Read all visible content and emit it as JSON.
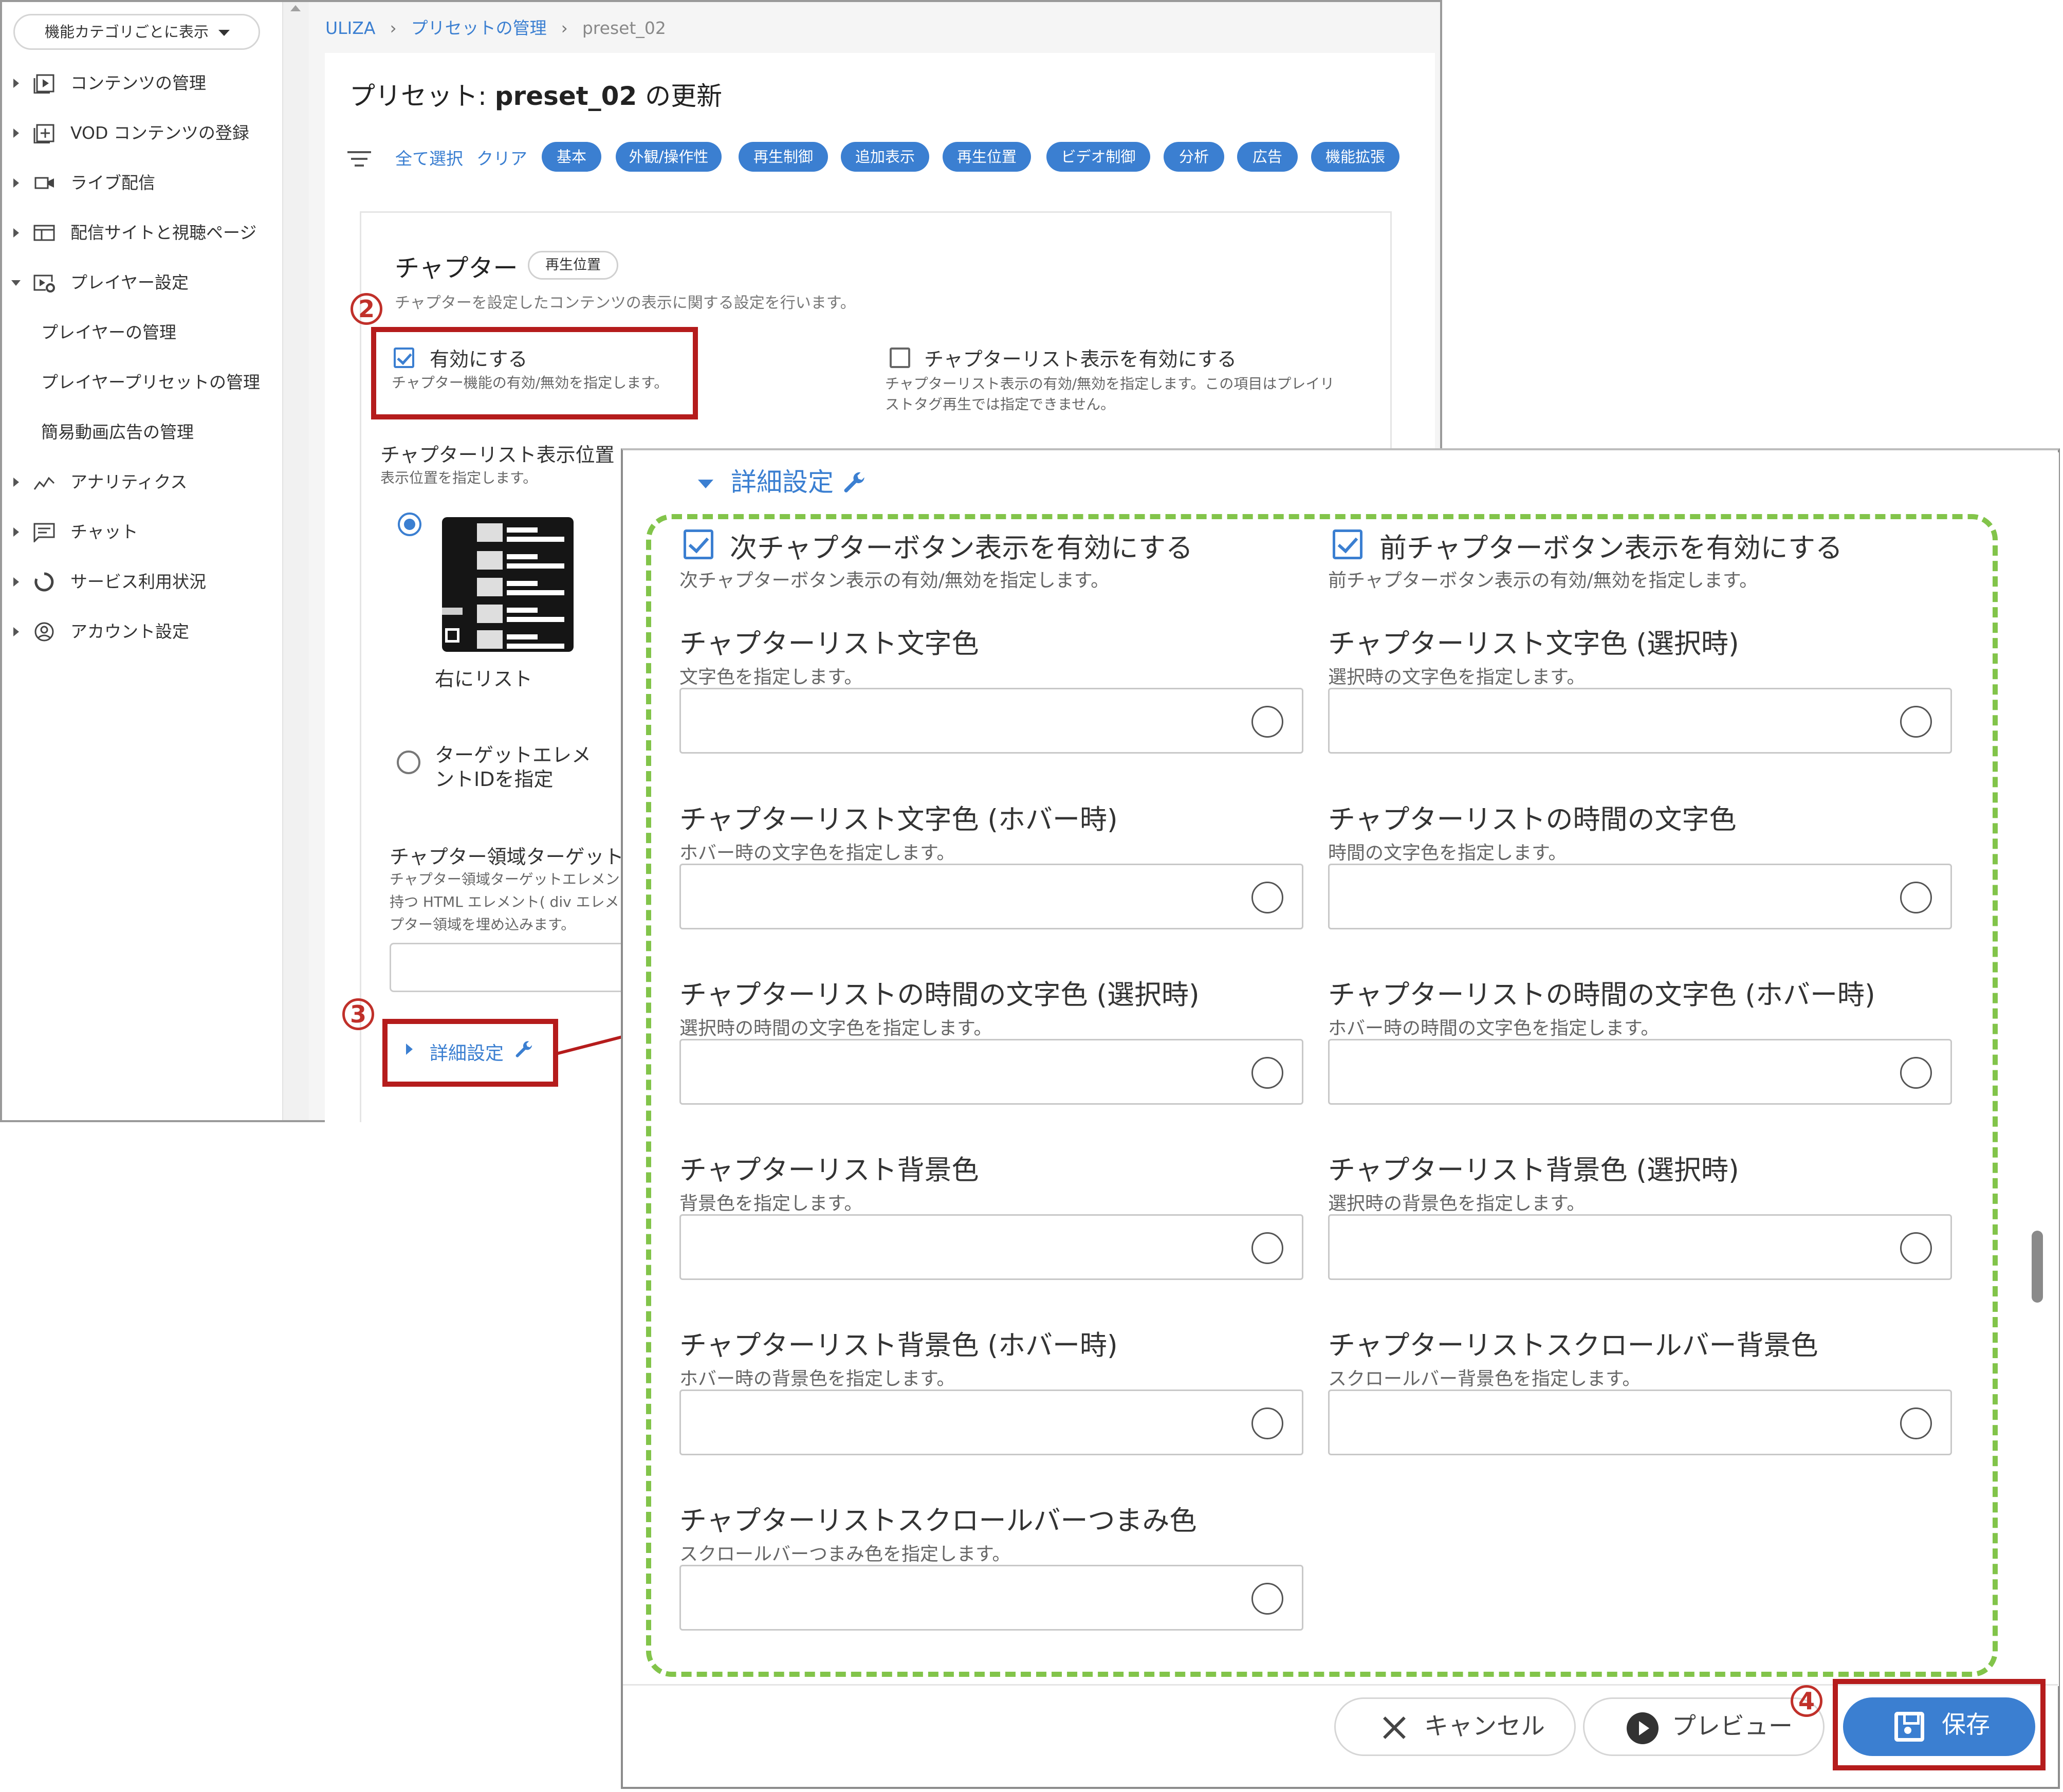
{
  "sidebar": {
    "category_dropdown": "機能カテゴリごとに表示",
    "items": [
      {
        "label": "コンテンツの管理",
        "icon": "play-square-icon",
        "expanded": false
      },
      {
        "label": "VOD コンテンツの登録",
        "icon": "add-box-icon",
        "expanded": false
      },
      {
        "label": "ライブ配信",
        "icon": "video-camera-icon",
        "expanded": false
      },
      {
        "label": "配信サイトと視聴ページ",
        "icon": "web-page-icon",
        "expanded": false
      },
      {
        "label": "プレイヤー設定",
        "icon": "player-settings-icon",
        "expanded": true
      },
      {
        "label": "アナリティクス",
        "icon": "analytics-icon",
        "expanded": false
      },
      {
        "label": "チャット",
        "icon": "chat-icon",
        "expanded": false
      },
      {
        "label": "サービス利用状況",
        "icon": "usage-donut-icon",
        "expanded": false
      },
      {
        "label": "アカウント設定",
        "icon": "account-circle-icon",
        "expanded": false
      }
    ],
    "subitems": [
      "プレイヤーの管理",
      "プレイヤープリセットの管理",
      "簡易動画広告の管理"
    ]
  },
  "breadcrumb": {
    "root": "ULIZA",
    "parent": "プリセットの管理",
    "current": "preset_02"
  },
  "page_title": {
    "prefix": "プリセット: ",
    "name": "preset_02",
    "suffix": " の更新"
  },
  "filter": {
    "select_all": "全て選択",
    "clear": "クリア",
    "chips": [
      "基本",
      "外観/操作性",
      "再生制御",
      "追加表示",
      "再生位置",
      "ビデオ制御",
      "分析",
      "広告",
      "機能拡張"
    ]
  },
  "section": {
    "title": "チャプター",
    "tag": "再生位置",
    "desc": "チャプターを設定したコンテンツの表示に関する設定を行います。",
    "enable": {
      "label": "有効にする",
      "desc": "チャプター機能の有効/無効を指定します。",
      "checked": true
    },
    "list_enable": {
      "label": "チャプターリスト表示を有効にする",
      "desc1": "チャプターリスト表示の有効/無効を指定します。この項目はプレイリ",
      "desc2": "ストタグ再生では指定できません。",
      "checked": false
    },
    "list_position": {
      "label": "チャプターリスト表示位置",
      "desc": "表示位置を指定します。",
      "option_right": "右にリスト",
      "option_target1": "ターゲットエレメ",
      "option_target2": "ントIDを指定",
      "selected": "右にリスト"
    },
    "target_area": {
      "label": "チャプター領域ターゲット",
      "desc1": "チャプター領域ターゲットエレメン",
      "desc2": "持つ HTML エレメント( div エレメ",
      "desc3": "プター領域を埋め込みます。"
    },
    "advanced_link": "詳細設定"
  },
  "annotations": {
    "m2": "2",
    "m3": "3",
    "m4": "4"
  },
  "advanced": {
    "title": "詳細設定",
    "next_btn": {
      "label": "次チャプターボタン表示を有効にする",
      "desc": "次チャプターボタン表示の有効/無効を指定します。",
      "checked": true
    },
    "prev_btn": {
      "label": "前チャプターボタン表示を有効にする",
      "desc": "前チャプターボタン表示の有効/無効を指定します。",
      "checked": true
    },
    "fields": [
      {
        "label": "チャプターリスト文字色",
        "desc": "文字色を指定します。",
        "value": ""
      },
      {
        "label": "チャプターリスト文字色 (選択時)",
        "desc": "選択時の文字色を指定します。",
        "value": ""
      },
      {
        "label": "チャプターリスト文字色 (ホバー時)",
        "desc": "ホバー時の文字色を指定します。",
        "value": ""
      },
      {
        "label": "チャプターリストの時間の文字色",
        "desc": "時間の文字色を指定します。",
        "value": ""
      },
      {
        "label": "チャプターリストの時間の文字色 (選択時)",
        "desc": "選択時の時間の文字色を指定します。",
        "value": ""
      },
      {
        "label": "チャプターリストの時間の文字色 (ホバー時)",
        "desc": "ホバー時の時間の文字色を指定します。",
        "value": ""
      },
      {
        "label": "チャプターリスト背景色",
        "desc": "背景色を指定します。",
        "value": ""
      },
      {
        "label": "チャプターリスト背景色 (選択時)",
        "desc": "選択時の背景色を指定します。",
        "value": ""
      },
      {
        "label": "チャプターリスト背景色 (ホバー時)",
        "desc": "ホバー時の背景色を指定します。",
        "value": ""
      },
      {
        "label": "チャプターリストスクロールバー背景色",
        "desc": "スクロールバー背景色を指定します。",
        "value": ""
      },
      {
        "label": "チャプターリストスクロールバーつまみ色",
        "desc": "スクロールバーつまみ色を指定します。",
        "value": ""
      }
    ]
  },
  "footer": {
    "cancel": "キャンセル",
    "preview": "プレビュー",
    "save": "保存"
  },
  "colors": {
    "accent": "#3b7fd1",
    "highlight": "#b51c1c",
    "dashed": "#82c44a"
  }
}
